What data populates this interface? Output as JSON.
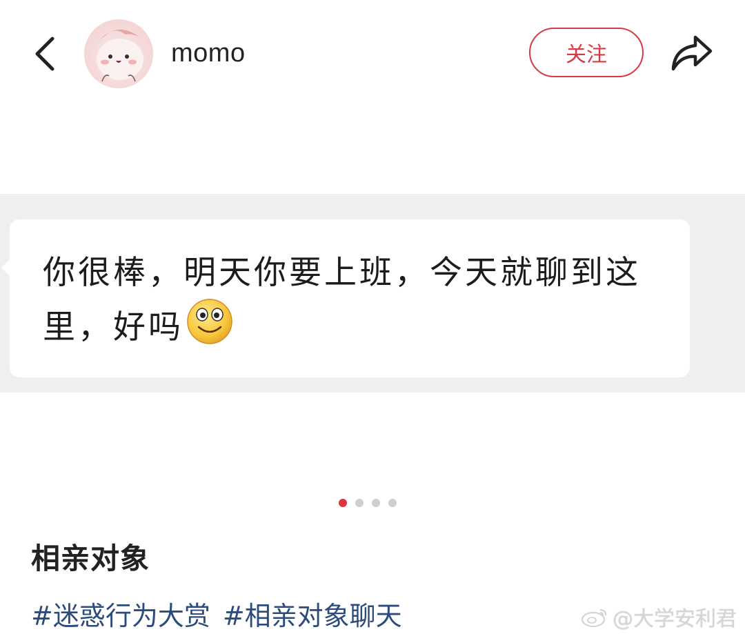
{
  "header": {
    "username": "momo",
    "follow_label": "关注"
  },
  "message": {
    "text": "你很棒，明天你要上班，今天就聊到这里，好吗",
    "emoji": "smiley-emoji"
  },
  "carousel": {
    "total_pages": 4,
    "current_page": 1
  },
  "post": {
    "title": "相亲对象",
    "tags": [
      "#迷惑行为大赏",
      "#相亲对象聊天"
    ]
  },
  "watermark": {
    "text": "@大学安利君"
  },
  "colors": {
    "accent": "#d63a45",
    "tag": "#2c4a7c",
    "image_bg": "#efefef"
  }
}
